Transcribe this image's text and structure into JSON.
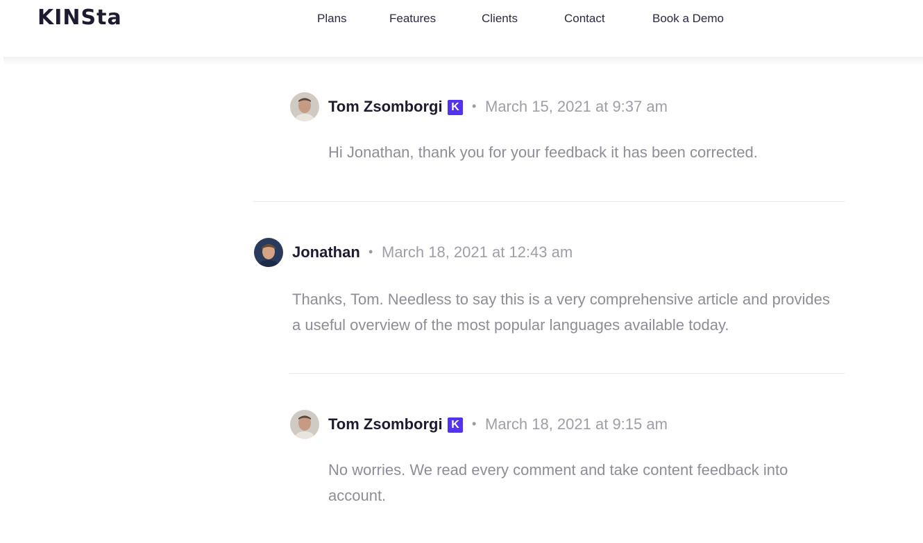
{
  "brand": {
    "logo_text": "KINSta"
  },
  "nav": {
    "items": [
      {
        "label": "Plans"
      },
      {
        "label": "Features"
      },
      {
        "label": "Clients"
      },
      {
        "label": "Contact"
      },
      {
        "label": "Book a Demo"
      }
    ]
  },
  "comments": [
    {
      "author": "Tom Zsomborgi",
      "badge": "K",
      "separator": "•",
      "date": "March 15, 2021 at 9:37 am",
      "body": "Hi Jonathan, thank you for your feedback it has been corrected."
    },
    {
      "author": "Jonathan",
      "separator": "•",
      "date": "March 18, 2021 at 12:43 am",
      "body": "Thanks, Tom. Needless to say this is a very comprehensive article and provides a useful overview of the most popular languages available today."
    },
    {
      "author": "Tom Zsomborgi",
      "badge": "K",
      "separator": "•",
      "date": "March 18, 2021 at 9:15 am",
      "body": "No worries. We read every comment and take content feedback into account."
    }
  ],
  "colors": {
    "brand_text": "#1d1b2f",
    "badge_bg": "#5333ed",
    "meta_text": "#9e9ea8",
    "body_text": "#8d8d97",
    "divider": "#e9e9ef"
  }
}
